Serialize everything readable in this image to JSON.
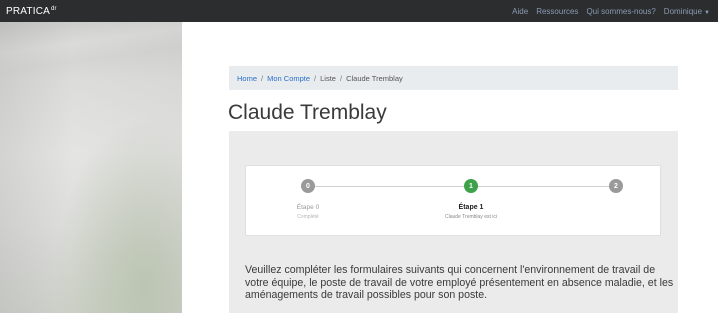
{
  "topbar": {
    "brand": "PRATICA",
    "brand_sup": "dr",
    "nav": [
      "Aide",
      "Ressources",
      "Qui sommes-nous?",
      "Dominique"
    ]
  },
  "breadcrumb": {
    "home": "Home",
    "account": "Mon Compte",
    "list": "Liste",
    "current": "Claude Tremblay",
    "separator": "/"
  },
  "page": {
    "title": "Claude Tremblay"
  },
  "stepper": {
    "steps": [
      {
        "number": "0",
        "label": "Étape 0",
        "sub": "Complété",
        "state": "done"
      },
      {
        "number": "1",
        "label": "Étape 1",
        "sub": "Claude Tremblay est ici",
        "state": "active"
      },
      {
        "number": "2",
        "label": "",
        "sub": "",
        "state": "pending"
      }
    ]
  },
  "description": "Veuillez compléter les formulaires suivants qui concernent l'environnement de travail de votre équipe, le poste de travail de votre employé présentement en absence maladie, et les aménagements de travail possibles pour son poste.",
  "colors": {
    "topbar": "#2b2d2f",
    "accent_link": "#2a6fc9",
    "step_active": "#3ea24a",
    "step_inactive": "#9a9a9a",
    "panel": "#ebebeb"
  }
}
